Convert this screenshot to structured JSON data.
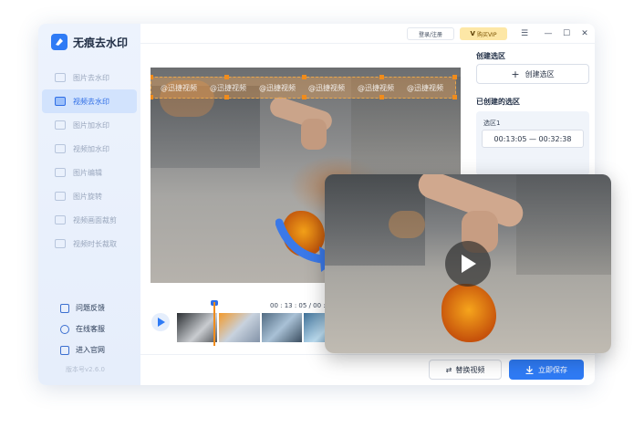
{
  "app": {
    "name": "无痕去水印",
    "version": "版本号v2.6.0"
  },
  "titlebar": {
    "login_label": "登录/注册",
    "vip_label": "购买VIP",
    "vip_mark": "V",
    "menu_icon": "menu-icon",
    "minimize_icon": "minimize-icon",
    "maximize_icon": "maximize-icon",
    "close_icon": "close-icon",
    "menu_glyph": "☰",
    "minimize_glyph": "—",
    "maximize_glyph": "☐",
    "close_glyph": "✕"
  },
  "sidebar": {
    "items": [
      {
        "label": "图片去水印",
        "active": false
      },
      {
        "label": "视频去水印",
        "active": true
      },
      {
        "label": "图片加水印",
        "active": false
      },
      {
        "label": "视频加水印",
        "active": false
      },
      {
        "label": "图片编辑",
        "active": false
      },
      {
        "label": "图片旋转",
        "active": false
      },
      {
        "label": "视频画面裁剪",
        "active": false
      },
      {
        "label": "视频时长裁取",
        "active": false
      }
    ],
    "links": [
      {
        "label": "问题反馈",
        "icon": "feedback-icon"
      },
      {
        "label": "在线客服",
        "icon": "support-icon"
      },
      {
        "label": "进入官网",
        "icon": "website-icon"
      }
    ]
  },
  "video": {
    "watermark_text": "@迅捷视频"
  },
  "right_panel": {
    "create_section_title": "创建选区",
    "create_button_label": "创建选区",
    "created_section_title": "已创建的选区",
    "regions": [
      {
        "name": "选区1",
        "time_range": "00:13:05 — 00:32:38"
      }
    ]
  },
  "timeline": {
    "time_display": "00 : 13 : 05 / 00 : 5"
  },
  "bottom": {
    "replace_label": "替换视频",
    "save_label": "立即保存"
  },
  "colors": {
    "accent": "#2f7bf5",
    "vip": "#fde7a6",
    "watermark_box": "#f08c1c"
  }
}
